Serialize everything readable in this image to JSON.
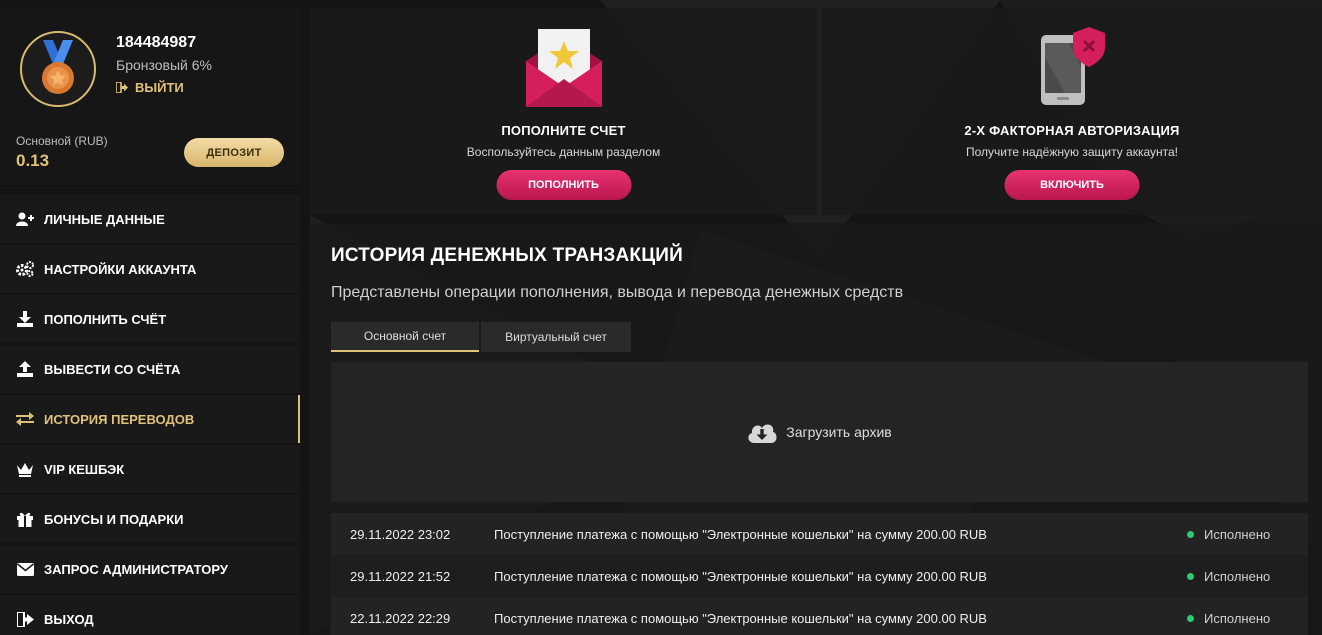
{
  "profile": {
    "user_id": "184484987",
    "level": "Бронзовый 6%",
    "logout_label": "ВЫЙТИ",
    "account_label": "Основной (RUB)",
    "balance": "0.13",
    "deposit_label": "ДЕПОЗИТ"
  },
  "menu": [
    {
      "label": "ЛИЧНЫЕ ДАННЫЕ",
      "icon": "user-plus-icon"
    },
    {
      "label": "НАСТРОЙКИ АККАУНТА",
      "icon": "gears-icon"
    },
    {
      "label": "ПОПОЛНИТЬ СЧЁТ",
      "icon": "download-icon"
    },
    {
      "label": "ВЫВЕСТИ СО СЧЁТА",
      "icon": "upload-icon"
    },
    {
      "label": "ИСТОРИЯ ПЕРЕВОДОВ",
      "icon": "exchange-icon",
      "active": true
    },
    {
      "label": "VIP КЕШБЭК",
      "icon": "crown-icon"
    },
    {
      "label": "БОНУСЫ И ПОДАРКИ",
      "icon": "gift-icon"
    },
    {
      "label": "ЗАПРОС АДМИНИСТРАТОРУ",
      "icon": "envelope-icon"
    },
    {
      "label": "ВЫХОД",
      "icon": "logout-icon"
    }
  ],
  "cards": {
    "deposit": {
      "title": "ПОПОЛНИТЕ СЧЕТ",
      "subtitle": "Воспользуйтесь данным разделом",
      "button": "ПОПОЛНИТЬ"
    },
    "twofa": {
      "title": "2-Х ФАКТОРНАЯ АВТОРИЗАЦИЯ",
      "subtitle": "Получите надёжную защиту аккаунта!",
      "button": "ВКЛЮЧИТЬ"
    }
  },
  "history": {
    "title": "ИСТОРИЯ ДЕНЕЖНЫХ ТРАНЗАКЦИЙ",
    "subtitle": "Представлены операции пополнения, вывода и перевода денежных средств",
    "tabs": [
      "Основной счет",
      "Виртуальный счет"
    ],
    "archive_label": "Загрузить архив",
    "rows": [
      {
        "date": "29.11.2022 23:02",
        "description": "Поступление платежа с помощью \"Электронные кошельки\" на сумму 200.00 RUB",
        "status": "Исполнено"
      },
      {
        "date": "29.11.2022 21:52",
        "description": "Поступление платежа с помощью \"Электронные кошельки\" на сумму 200.00 RUB",
        "status": "Исполнено"
      },
      {
        "date": "22.11.2022 22:29",
        "description": "Поступление платежа с помощью \"Электронные кошельки\" на сумму 200.00 RUB",
        "status": "Исполнено"
      }
    ]
  },
  "colors": {
    "gold": "#e0c179",
    "pink": "#d81f5f",
    "status_ok": "#2ecc71"
  }
}
